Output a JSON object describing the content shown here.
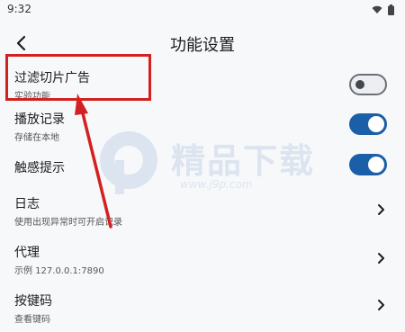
{
  "status_bar": {
    "time": "9:32",
    "icons": [
      "wifi-icon",
      "battery-icon"
    ]
  },
  "header": {
    "title": "功能设置",
    "back_icon": "back-arrow-icon"
  },
  "settings": [
    {
      "label": "过滤切片广告",
      "subtitle": "实验功能",
      "control": "toggle",
      "enabled": false
    },
    {
      "label": "播放记录",
      "subtitle": "存储在本地",
      "control": "toggle",
      "enabled": true
    },
    {
      "label": "触感提示",
      "subtitle": "",
      "control": "toggle",
      "enabled": true
    },
    {
      "label": "日志",
      "subtitle": "使用出现异常时可开启记录",
      "control": "chevron"
    },
    {
      "label": "代理",
      "subtitle": "示例 127.0.0.1:7890",
      "control": "chevron"
    },
    {
      "label": "按键码",
      "subtitle": "查看键码",
      "control": "chevron"
    }
  ],
  "watermark": {
    "text": "精品下载",
    "url": "www.j9p.com"
  },
  "colors": {
    "accent": "#1a5fa7",
    "annotation": "#d32020",
    "background": "#f7f8fa"
  }
}
